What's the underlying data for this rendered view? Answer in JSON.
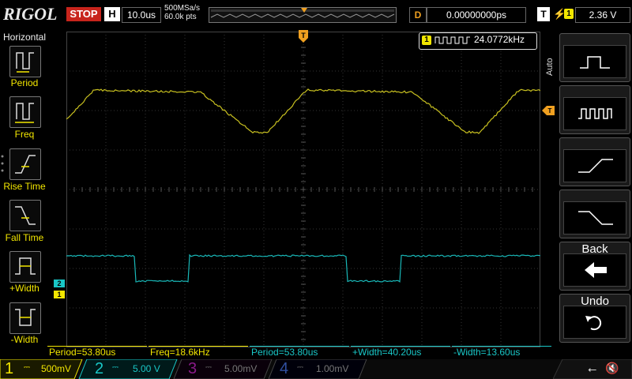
{
  "topbar": {
    "logo": "RIGOL",
    "run_status": "STOP",
    "timebase_label": "H",
    "timebase": "10.0us",
    "sample_rate": "500MSa/s",
    "memory_depth": "60.0k pts",
    "delay_label": "D",
    "delay": "0.00000000ps",
    "trigger_label": "T",
    "trigger_source": "1",
    "trigger_level": "2.36 V"
  },
  "left_menu": {
    "title": "Horizontal",
    "items": [
      {
        "label": "Period"
      },
      {
        "label": "Freq"
      },
      {
        "label": "Rise Time"
      },
      {
        "label": "Fall Time"
      },
      {
        "label": "+Width"
      },
      {
        "label": "-Width"
      }
    ]
  },
  "counter": {
    "source": "1",
    "value": "24.0772kHz"
  },
  "right_menu": {
    "mode": "Auto",
    "back_label": "Back",
    "undo_label": "Undo"
  },
  "measurements": [
    {
      "text": "Period=53.80us"
    },
    {
      "text": "Freq=18.6kHz"
    },
    {
      "text": "Period=53.80us"
    },
    {
      "text": "+Width=40.20us"
    },
    {
      "text": "-Width=13.60us"
    }
  ],
  "channels": [
    {
      "num": "1",
      "scale": "500mV",
      "color": "#f2e600"
    },
    {
      "num": "2",
      "scale": "5.00 V",
      "color": "#19c7c7"
    },
    {
      "num": "3",
      "scale": "5.00mV",
      "color": "#c020c0"
    },
    {
      "num": "4",
      "scale": "1.00mV",
      "color": "#2060e0"
    }
  ],
  "markers": {
    "trigger_pos": "T",
    "ch1_marker": "1",
    "ch2_marker": "2"
  },
  "colors": {
    "ch1": "#f2e600",
    "ch2": "#19c7c7",
    "trigger": "#f0a020",
    "stop": "#c8241c"
  }
}
